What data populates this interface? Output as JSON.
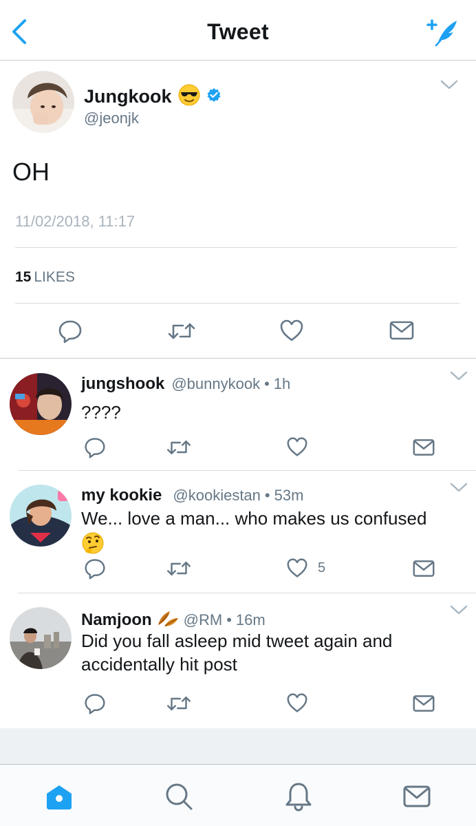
{
  "header": {
    "title": "Tweet"
  },
  "main_tweet": {
    "name": "Jungkook",
    "handle": "@jeonjk",
    "text": "OH",
    "timestamp": "11/02/2018, 11:17",
    "likes_count": "15",
    "likes_label": "LIKES"
  },
  "replies": [
    {
      "name": "jungshook",
      "handle": "@bunnykook",
      "dot": "•",
      "time": "1h",
      "text": "????",
      "likes": ""
    },
    {
      "name": "my kookie",
      "handle": "@kookiestan",
      "dot": "•",
      "time": "53m",
      "text": "We... love a man... who makes us confused",
      "likes": "5"
    },
    {
      "name": "Namjoon",
      "handle": "@RM",
      "dot": "•",
      "time": "16m",
      "text": "Did you fall asleep mid tweet again and accidentally hit post",
      "likes": ""
    }
  ],
  "icons": {
    "back": "chevron-left-icon",
    "compose": "compose-tweet-icon",
    "verified": "verified-badge-icon",
    "reply": "reply-icon",
    "retweet": "retweet-icon",
    "like": "heart-icon",
    "dm": "envelope-icon",
    "home": "home-icon",
    "search": "search-icon",
    "notifications": "bell-icon",
    "messages": "envelope-icon"
  },
  "colors": {
    "accent": "#1da1f2",
    "text": "#14171a",
    "secondary": "#657786",
    "border": "#c8ccd0"
  }
}
